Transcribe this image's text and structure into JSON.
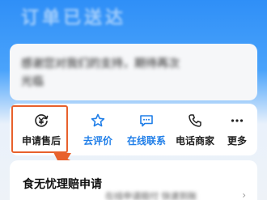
{
  "header": {
    "status_title": "订单已送达"
  },
  "order_card": {
    "line1": "感谢您对我们的支持，期待再次",
    "line2": "光临"
  },
  "actions": {
    "after_sales": {
      "label": "申请售后",
      "icon": "after-sales-icon"
    },
    "review": {
      "label": "去评价",
      "icon": "star-icon"
    },
    "chat": {
      "label": "在线联系",
      "icon": "chat-bubble-icon"
    },
    "call": {
      "label": "电话商家",
      "icon": "phone-icon"
    },
    "more": {
      "label": "更多",
      "icon": "more-dots-icon"
    }
  },
  "claim_card": {
    "title": "食无忧理赔申请",
    "subtitle": "在线申请赔付 快速到账",
    "chevron": "›"
  },
  "colors": {
    "accent_blue": "#1f7ee8",
    "highlight_orange": "#e8612c",
    "header_blue": "#2f8ff7"
  }
}
